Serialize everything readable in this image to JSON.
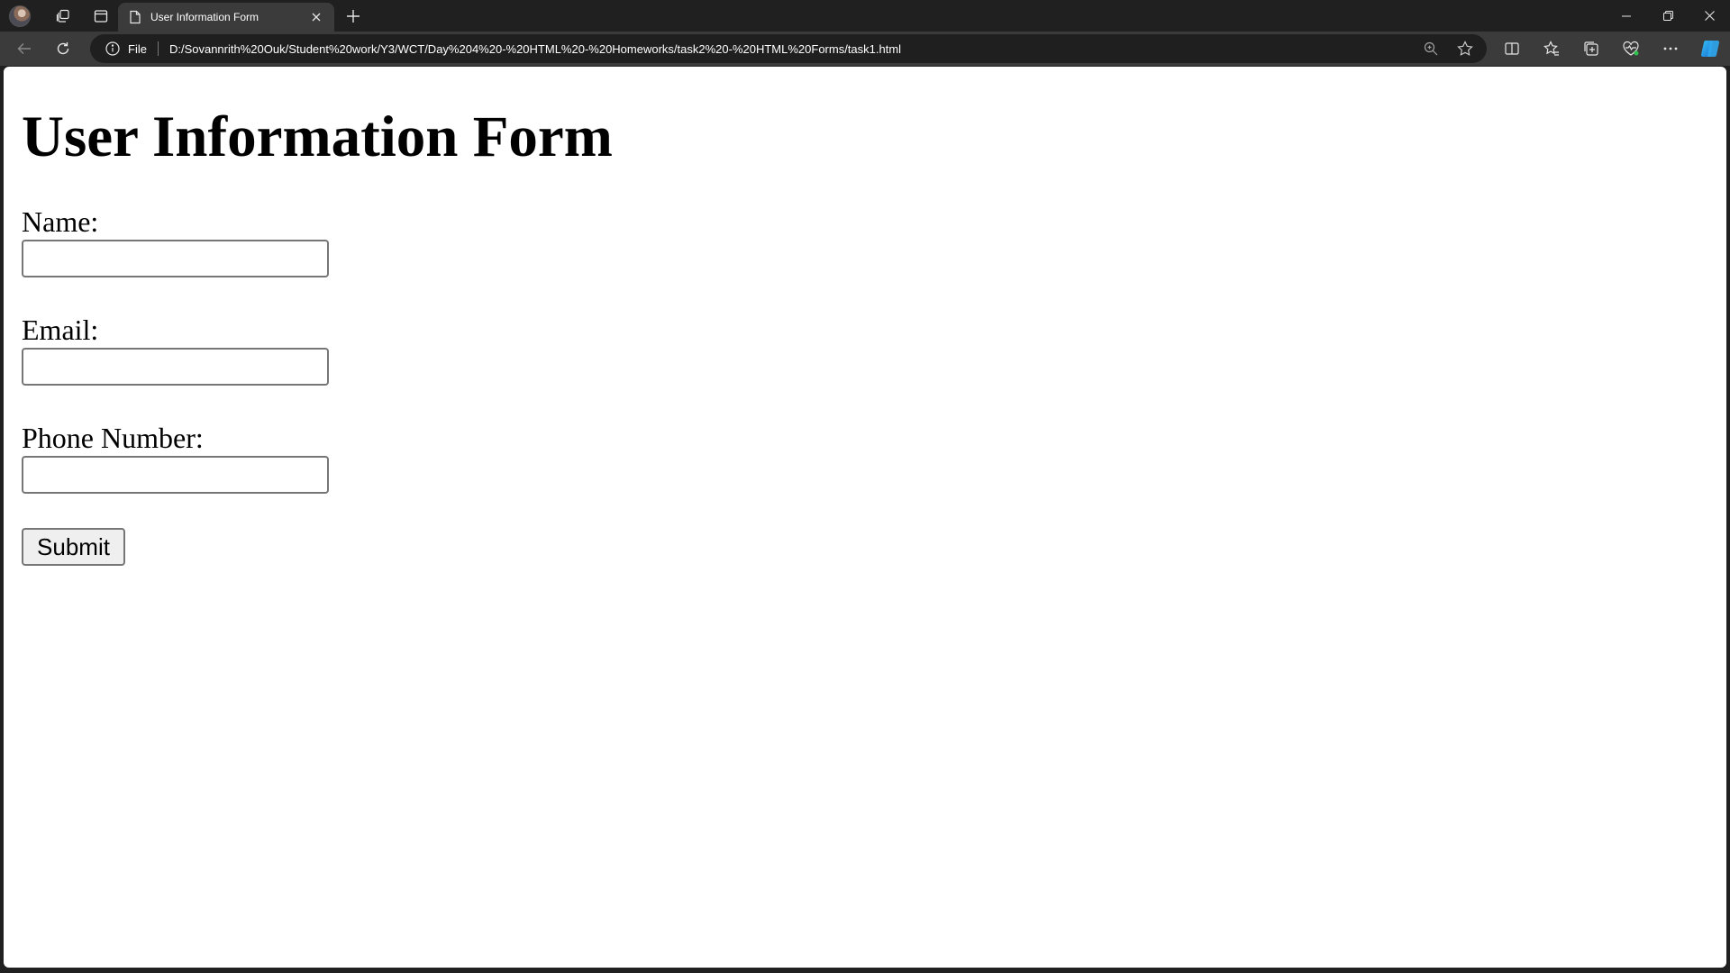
{
  "browser": {
    "tab_title": "User Information Form",
    "address_scheme_label": "File",
    "url": "D:/Sovannrith%20Ouk/Student%20work/Y3/WCT/Day%204%20-%20HTML%20-%20Homeworks/task2%20-%20HTML%20Forms/task1.html",
    "icons": {
      "profile": "avatar-icon",
      "workspaces": "workspaces-icon",
      "tab_actions": "vertical-tabs-icon",
      "page": "page-icon",
      "close_tab": "close-icon",
      "new_tab": "plus-icon",
      "back": "back-arrow-icon",
      "refresh": "refresh-icon",
      "site_info": "info-icon",
      "zoom": "zoom-icon",
      "favorite": "star-icon",
      "split_screen": "split-screen-icon",
      "favorites": "favorites-icon",
      "collections": "collections-icon",
      "browser_essentials": "heart-pulse-icon",
      "more": "more-icon",
      "copilot": "copilot-icon",
      "minimize": "minimize-icon",
      "restore": "restore-icon",
      "close_window": "close-window-icon"
    }
  },
  "page": {
    "heading": "User Information Form",
    "fields": [
      {
        "label": "Name:",
        "value": ""
      },
      {
        "label": "Email:",
        "value": ""
      },
      {
        "label": "Phone Number:",
        "value": ""
      }
    ],
    "submit_label": "Submit"
  }
}
